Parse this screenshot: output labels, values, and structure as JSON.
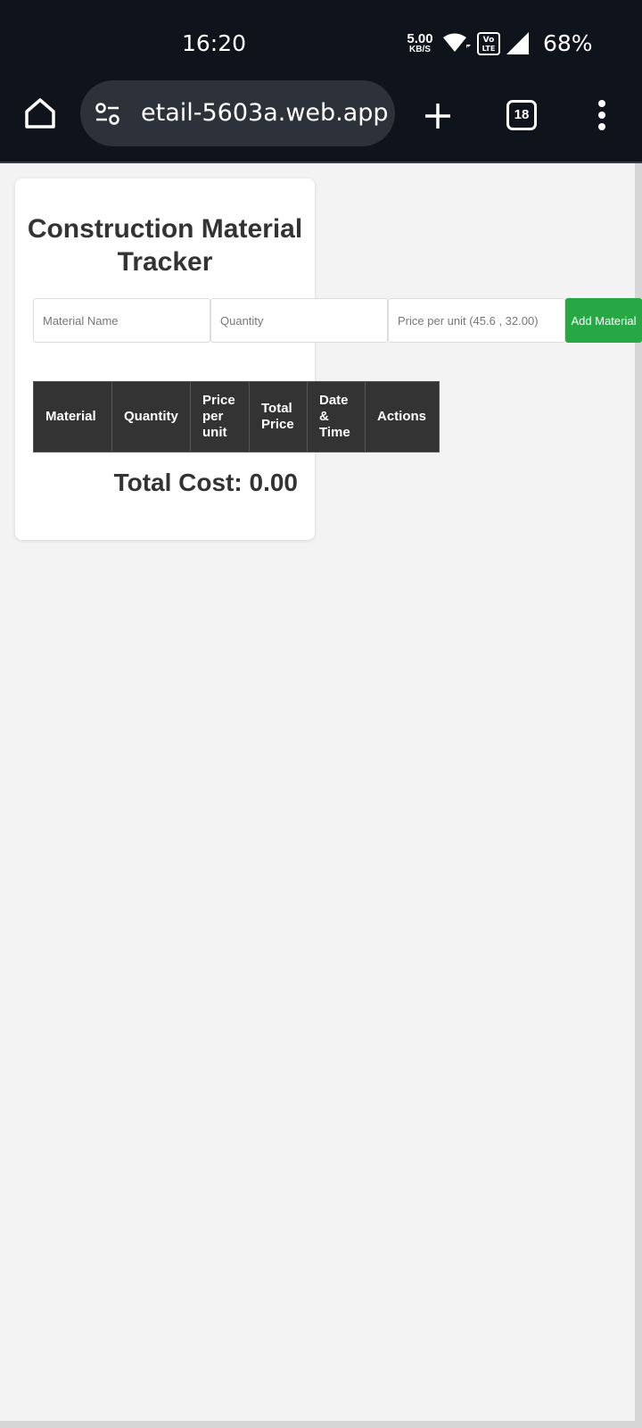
{
  "status_bar": {
    "time": "16:20",
    "net_speed_value": "5.00",
    "net_speed_unit": "KB/S",
    "battery": "68%"
  },
  "browser": {
    "url_text": "etail-5603a.web.app",
    "tab_count": "18"
  },
  "app": {
    "title": "Construction Material Tracker",
    "inputs": {
      "material_placeholder": "Material Name",
      "quantity_placeholder": "Quantity",
      "price_placeholder": "Price per unit (45.6 , 32.00)"
    },
    "add_button_label": "Add Material",
    "table_headers": [
      "Material",
      "Quantity",
      "Price per unit",
      "Total Price",
      "Date & Time",
      "Actions"
    ],
    "rows": [],
    "total_label": "Total Cost:",
    "total_value": "0.00"
  },
  "colors": {
    "accent_green": "#28a745",
    "table_header_bg": "#333333",
    "browser_bg": "#0f131b",
    "page_bg": "#f3f3f3"
  }
}
